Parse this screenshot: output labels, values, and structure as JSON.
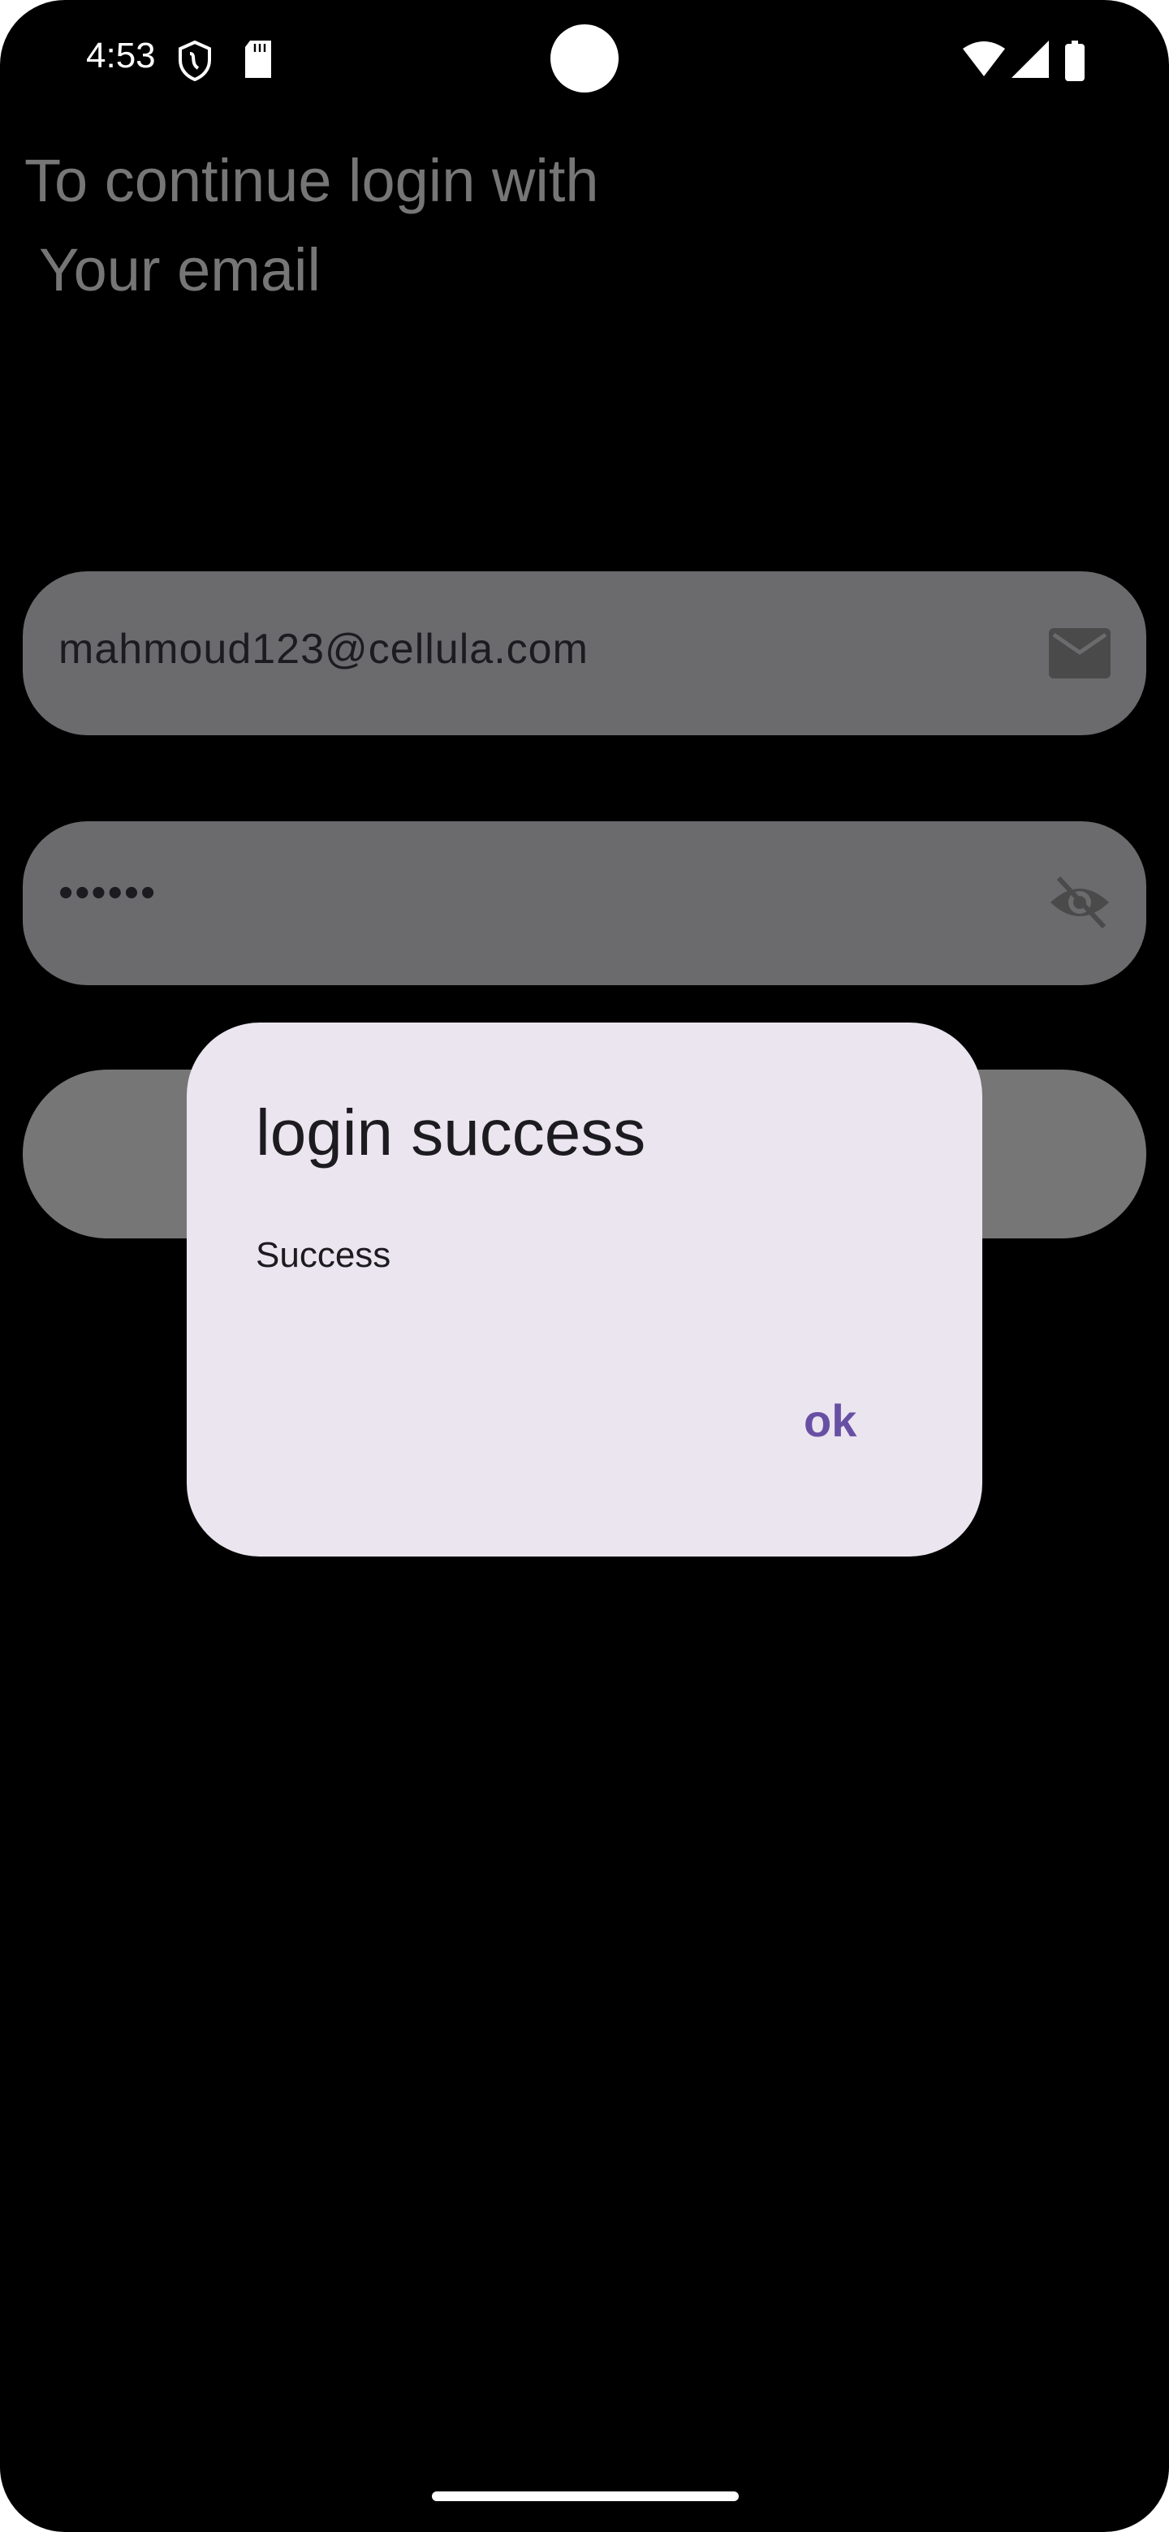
{
  "status_bar": {
    "time": "4:53",
    "icons": [
      "shield-icon",
      "sd-card-icon",
      "wifi-icon",
      "signal-icon",
      "battery-icon"
    ]
  },
  "heading": {
    "line1": "To continue login with",
    "line2": "Your email"
  },
  "email_field": {
    "value": "mahmoud123@cellula.com",
    "icon": "mail-icon"
  },
  "password_field": {
    "value": "••••••",
    "icon": "eye-off-icon"
  },
  "dialog": {
    "title": "login success",
    "message": "Success",
    "ok_label": "ok"
  },
  "colors": {
    "accent": "#6750a4",
    "dialog_bg": "#ebe5f0",
    "field_bg": "#6b6a6d"
  }
}
